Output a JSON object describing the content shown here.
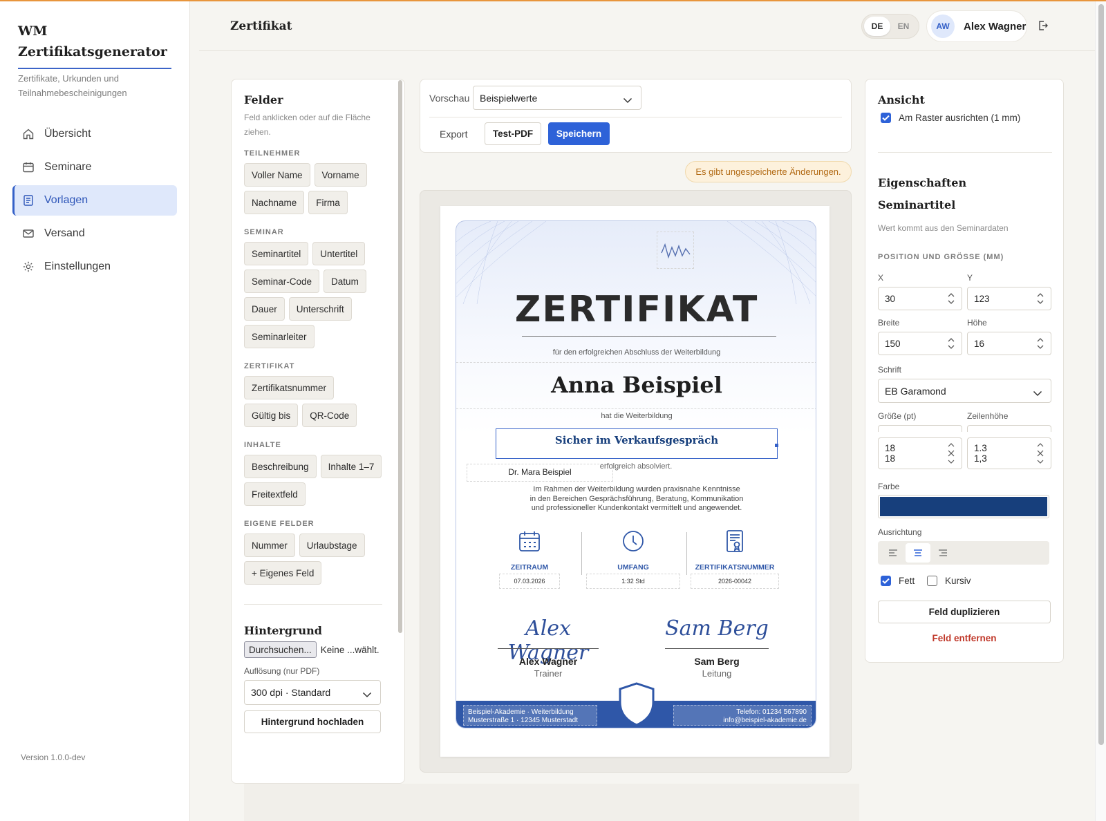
{
  "app": {
    "brand_line1": "WM",
    "brand_line2": "Zertifikatsgenerator",
    "brand_sub": "Zertifikate, Urkunden und Teilnahmebescheinigungen",
    "version": "Version 1.0.0-dev"
  },
  "nav": [
    {
      "label": "Übersicht",
      "icon": "home-icon"
    },
    {
      "label": "Seminare",
      "icon": "calendar-icon"
    },
    {
      "label": "Vorlagen",
      "icon": "document-icon",
      "active": true
    },
    {
      "label": "Versand",
      "icon": "mail-icon"
    },
    {
      "label": "Einstellungen",
      "icon": "gear-icon"
    }
  ],
  "header": {
    "title": "Zertifikat",
    "lang_de": "DE",
    "lang_en": "EN",
    "lang_selected": "DE",
    "avatar": "AW",
    "user": "Alex Wagner"
  },
  "fields_panel": {
    "title": "Felder",
    "hint": "Feld anklicken oder auf die Fläche ziehen.",
    "groups": [
      {
        "label": "TEILNEHMER",
        "chips": [
          "Voller Name",
          "Vorname",
          "Nachname",
          "Firma"
        ]
      },
      {
        "label": "SEMINAR",
        "chips": [
          "Seminartitel",
          "Untertitel",
          "Seminar-Code",
          "Datum",
          "Dauer",
          "Unterschrift",
          "Seminarleiter"
        ]
      },
      {
        "label": "ZERTIFIKAT",
        "chips": [
          "Zertifikatsnummer",
          "Gültig bis",
          "QR-Code"
        ]
      },
      {
        "label": "INHALTE",
        "chips": [
          "Beschreibung",
          "Inhalte 1–7",
          "Freitextfeld"
        ]
      },
      {
        "label": "EIGENE FELDER",
        "chips": [
          "Nummer",
          "Urlaubstage",
          "+ Eigenes Feld"
        ]
      }
    ],
    "background_title": "Hintergrund",
    "file_button": "Durchsuchen...",
    "file_status": "Keine ...wählt.",
    "resolution_label": "Auflösung (nur PDF)",
    "resolution_value": "300 dpi · Standard",
    "upload_button": "Hintergrund hochladen"
  },
  "toolbar": {
    "preview_label": "Vorschau",
    "preview_value": "Beispielwerte",
    "export_label": "Export",
    "test_pdf": "Test-PDF",
    "save": "Speichern",
    "unsaved": "Es gibt ungespeicherte Änderungen."
  },
  "certificate": {
    "heading": "ZERTIFIKAT",
    "intro": "für den erfolgreichen Abschluss der Weiterbildung",
    "name": "Anna Beispiel",
    "has": "hat die Weiterbildung",
    "seminar_title": "Sicher im Verkaufsgespräch",
    "trainer_field": "Dr. Mara Beispiel",
    "completed": "erfolgreich absolviert.",
    "desc_line1": "Im Rahmen der Weiterbildung wurden praxisnahe Kenntnisse",
    "desc_line2": "in den Bereichen Gesprächsführung, Beratung, Kommunikation",
    "desc_line3": "und professioneller Kundenkontakt vermittelt und angewendet.",
    "info": [
      {
        "label": "ZEITRAUM",
        "value": "07.03.2026",
        "icon": "calendar-icon"
      },
      {
        "label": "UMFANG",
        "value": "1:32 Std",
        "icon": "clock-icon"
      },
      {
        "label": "ZERTIFIKATSNUMMER",
        "value": "2026-00042",
        "icon": "certificate-icon"
      }
    ],
    "sig1_script": "Alex Wagner",
    "sig1_name": "Alex Wagner",
    "sig1_role": "Trainer",
    "sig2_script": "Sam Berg",
    "sig2_name": "Sam Berg",
    "sig2_role": "Leitung",
    "footer_left1": "Beispiel-Akademie · Weiterbildung",
    "footer_left2": "Musterstraße 1 · 12345 Musterstadt",
    "footer_right1": "Telefon: 01234 567890",
    "footer_right2": "info@beispiel-akademie.de",
    "accent_color": "#2f57a8"
  },
  "properties": {
    "view_title": "Ansicht",
    "snap_label": "Am Raster ausrichten (1 mm)",
    "snap_checked": true,
    "props_title": "Eigenschaften",
    "field_name": "Seminartitel",
    "field_hint": "Wert kommt aus den Seminardaten",
    "pos_label": "POSITION UND GRÖSSE (MM)",
    "x_label": "X",
    "x_value": "30",
    "y_label": "Y",
    "y_value": "123",
    "w_label": "Breite",
    "w_value": "150",
    "h_label": "Höhe",
    "h_value": "16",
    "font_label": "Schrift",
    "font_value": "EB Garamond",
    "size_label": "Größe (pt)",
    "size_value": "18",
    "size_value2": "18",
    "lh_label": "Zeilenhöhe",
    "lh_value": "1.3",
    "lh_value2": "1,3",
    "color_label": "Farbe",
    "color_value": "#173f7c",
    "align_label": "Ausrichtung",
    "align_selected": "center",
    "bold_label": "Fett",
    "bold_checked": true,
    "italic_label": "Kursiv",
    "italic_checked": false,
    "duplicate": "Feld duplizieren",
    "remove": "Feld entfernen"
  }
}
